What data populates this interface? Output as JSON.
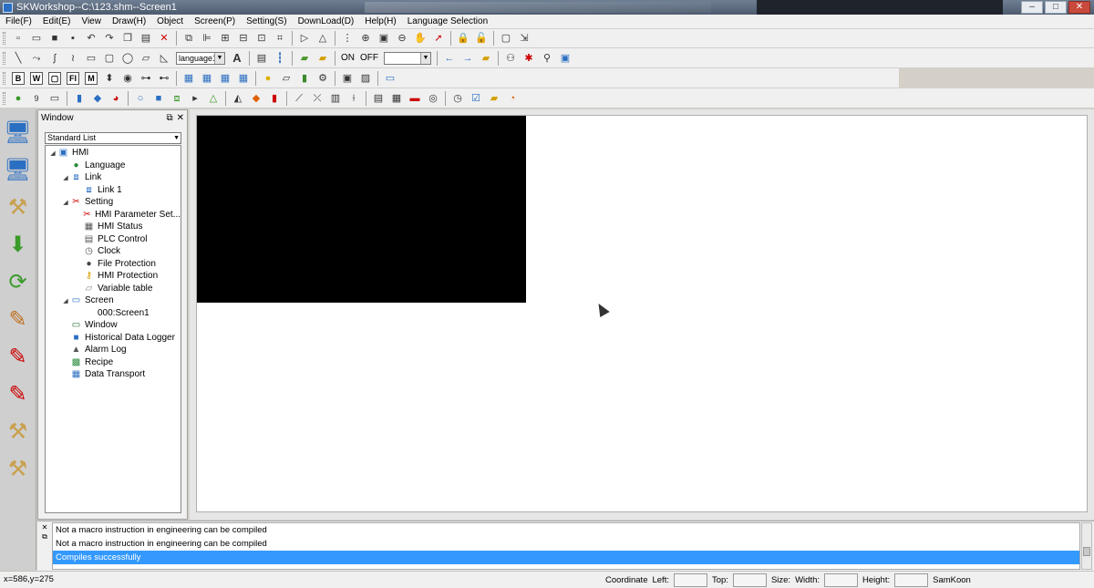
{
  "title_bar": {
    "title": "SKWorkshop--C:\\123.shm--Screen1"
  },
  "menu": [
    "File(F)",
    "Edit(E)",
    "View",
    "Draw(H)",
    "Object",
    "Screen(P)",
    "Setting(S)",
    "DownLoad(D)",
    "Help(H)",
    "Language Selection"
  ],
  "toolbar": {
    "language_combo": "language1",
    "on_label": "ON",
    "off_label": "OFF"
  },
  "window_panel": {
    "title": "Window",
    "list_type": "Standard List",
    "tree": [
      {
        "label": "HMI",
        "icon": "hmi-icon",
        "level": 0,
        "expander": "expanded"
      },
      {
        "label": "Language",
        "icon": "globe-icon",
        "level": 1,
        "expander": ""
      },
      {
        "label": "Link",
        "icon": "link-icon",
        "level": 1,
        "expander": "expanded"
      },
      {
        "label": "Link 1",
        "icon": "link-node-icon",
        "level": 2,
        "expander": ""
      },
      {
        "label": "Setting",
        "icon": "tools-icon",
        "level": 1,
        "expander": "expanded"
      },
      {
        "label": "HMI Parameter Set...",
        "icon": "wrench-icon",
        "level": 2,
        "expander": ""
      },
      {
        "label": "HMI Status",
        "icon": "status-icon",
        "level": 2,
        "expander": ""
      },
      {
        "label": "PLC Control",
        "icon": "plc-icon",
        "level": 2,
        "expander": ""
      },
      {
        "label": "Clock",
        "icon": "clock-icon",
        "level": 2,
        "expander": ""
      },
      {
        "label": "File Protection",
        "icon": "lock-icon",
        "level": 2,
        "expander": ""
      },
      {
        "label": "HMI Protection",
        "icon": "key-icon",
        "level": 2,
        "expander": ""
      },
      {
        "label": "Variable table",
        "icon": "table-icon",
        "level": 2,
        "expander": ""
      },
      {
        "label": "Screen",
        "icon": "screen-icon",
        "level": 1,
        "expander": "expanded"
      },
      {
        "label": "000:Screen1",
        "icon": "",
        "level": 2,
        "expander": ""
      },
      {
        "label": "Window",
        "icon": "window-icon",
        "level": 1,
        "expander": ""
      },
      {
        "label": "Historical Data Logger",
        "icon": "disk-icon",
        "level": 1,
        "expander": ""
      },
      {
        "label": "Alarm Log",
        "icon": "alarm-icon",
        "level": 1,
        "expander": ""
      },
      {
        "label": "Recipe",
        "icon": "recipe-icon",
        "level": 1,
        "expander": ""
      },
      {
        "label": "Data Transport",
        "icon": "transport-icon",
        "level": 1,
        "expander": ""
      }
    ]
  },
  "output": {
    "lines": [
      {
        "text": "Not a macro instruction in engineering can be compiled",
        "selected": false
      },
      {
        "text": "Not a macro instruction in engineering can be compiled",
        "selected": false
      },
      {
        "text": "Compiles successfully",
        "selected": true
      }
    ]
  },
  "status": {
    "coords": "x=586,y=275",
    "coordinate_label": "Coordinate",
    "left_label": "Left:",
    "top_label": "Top:",
    "size_label": "Size:",
    "width_label": "Width:",
    "height_label": "Height:",
    "brand": "SamKoon"
  },
  "colors": {
    "selection": "#3399ff",
    "canvas_screen": "#000000"
  }
}
